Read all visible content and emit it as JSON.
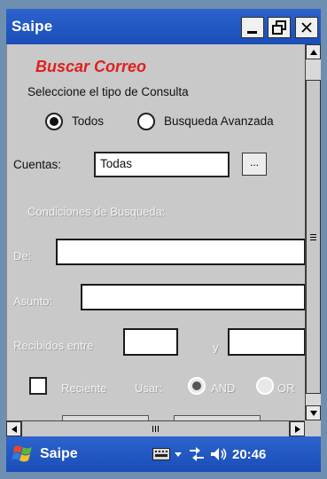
{
  "window": {
    "title": "Saipe",
    "buttons": {
      "minimize": "minimize-icon",
      "restore": "restore-icon",
      "close": "close-icon"
    }
  },
  "form": {
    "heading": "Buscar Correo",
    "query_type_label": "Seleccione el tipo de Consulta",
    "options": [
      {
        "label": "Todos",
        "selected": true
      },
      {
        "label": "Busqueda Avanzada",
        "selected": false
      }
    ],
    "accounts_label": "Cuentas:",
    "accounts_value": "Todas",
    "browse_label": "...",
    "conditions_label": "Condiciones de Busqueda:",
    "from_label": "De:",
    "subject_label": "Asunto:",
    "received_label": "Recibidos entre",
    "and_label": "y",
    "recent_label": "Reciente",
    "use_label": "Usar:",
    "logic_options": [
      {
        "label": "AND",
        "selected": true
      },
      {
        "label": "OR",
        "selected": false
      }
    ]
  },
  "taskbar": {
    "app_name": "Saipe",
    "time": "20:46",
    "icons": [
      "windows-start-icon",
      "keyboard-icon",
      "network-icon",
      "volume-icon"
    ]
  },
  "colors": {
    "title_bar": "#1f56c0",
    "heading": "#e01f1f",
    "background": "#c9c9c9"
  }
}
